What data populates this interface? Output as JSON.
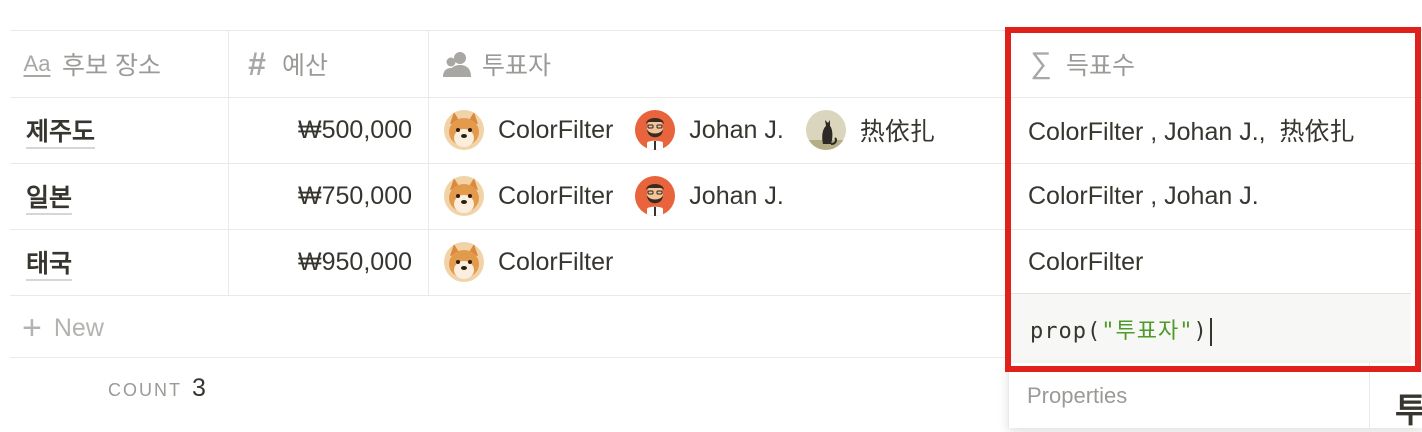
{
  "columns": {
    "place": "후보 장소",
    "budget": "예산",
    "voters": "투표자",
    "votes": "득표수"
  },
  "rows": [
    {
      "place": "제주도",
      "budget": "₩500,000",
      "voters": [
        "ColorFilter",
        "Johan J.",
        "热依扎"
      ],
      "votes": "ColorFilter , Johan J.,  热依扎"
    },
    {
      "place": "일본",
      "budget": "₩750,000",
      "voters": [
        "ColorFilter",
        "Johan J."
      ],
      "votes": "ColorFilter , Johan J."
    },
    {
      "place": "태국",
      "budget": "₩950,000",
      "voters": [
        "ColorFilter"
      ],
      "votes": "ColorFilter"
    }
  ],
  "new_row_label": "New",
  "footer": {
    "count_label": "COUNT",
    "count_value": "3"
  },
  "formula": {
    "prefix": "prop(",
    "string": "\"투표자\"",
    "suffix": ")"
  },
  "popup": {
    "properties_label": "Properties",
    "peek_text": "투"
  },
  "icons": {
    "place": "text-type-icon",
    "budget": "number-hash-icon",
    "voters": "people-icon",
    "votes": "formula-sigma-icon",
    "new": "plus-icon"
  },
  "colors": {
    "highlight": "#e0201b",
    "formula_string": "#4f9a2b"
  }
}
